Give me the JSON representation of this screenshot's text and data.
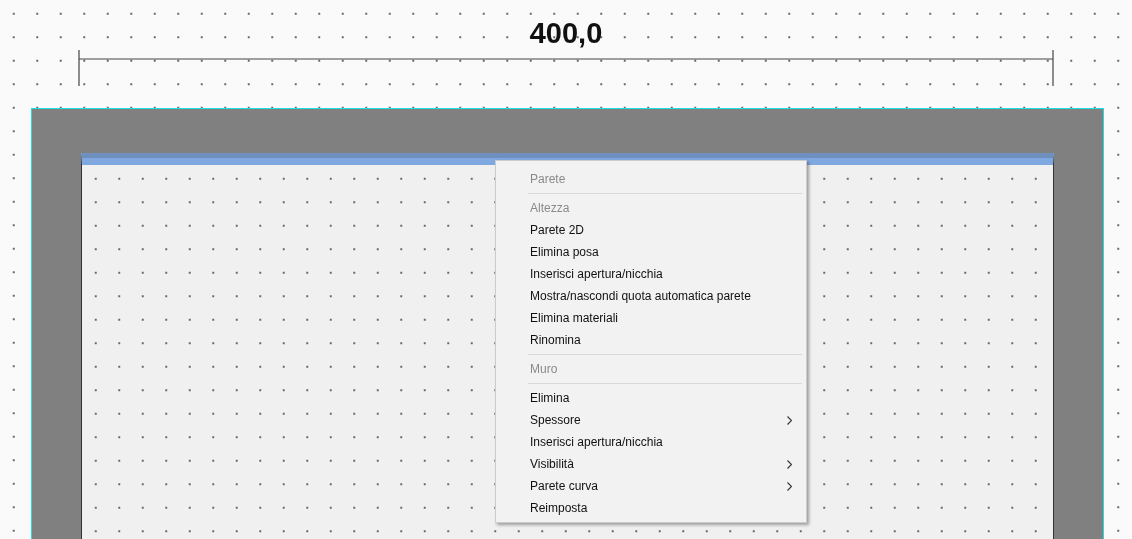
{
  "dimension": {
    "label": "400,0"
  },
  "context_menu": {
    "items": [
      {
        "kind": "header",
        "label": "Parete"
      },
      {
        "kind": "separator"
      },
      {
        "kind": "item",
        "label": "Altezza",
        "disabled": true,
        "has_submenu": false
      },
      {
        "kind": "item",
        "label": "Parete 2D",
        "disabled": false,
        "has_submenu": false
      },
      {
        "kind": "item",
        "label": "Elimina posa",
        "disabled": false,
        "has_submenu": false
      },
      {
        "kind": "item",
        "label": "Inserisci apertura/nicchia",
        "disabled": false,
        "has_submenu": false
      },
      {
        "kind": "item",
        "label": "Mostra/nascondi quota automatica parete",
        "disabled": false,
        "has_submenu": false
      },
      {
        "kind": "item",
        "label": "Elimina materiali",
        "disabled": false,
        "has_submenu": false
      },
      {
        "kind": "item",
        "label": "Rinomina",
        "disabled": false,
        "has_submenu": false
      },
      {
        "kind": "separator"
      },
      {
        "kind": "header",
        "label": "Muro"
      },
      {
        "kind": "separator"
      },
      {
        "kind": "item",
        "label": "Elimina",
        "disabled": false,
        "has_submenu": false
      },
      {
        "kind": "item",
        "label": "Spessore",
        "disabled": false,
        "has_submenu": true
      },
      {
        "kind": "item",
        "label": "Inserisci apertura/nicchia",
        "disabled": false,
        "has_submenu": false
      },
      {
        "kind": "item",
        "label": "Visibilità",
        "disabled": false,
        "has_submenu": true
      },
      {
        "kind": "item",
        "label": "Parete curva",
        "disabled": false,
        "has_submenu": true
      },
      {
        "kind": "item",
        "label": "Reimposta",
        "disabled": false,
        "has_submenu": false
      }
    ]
  }
}
